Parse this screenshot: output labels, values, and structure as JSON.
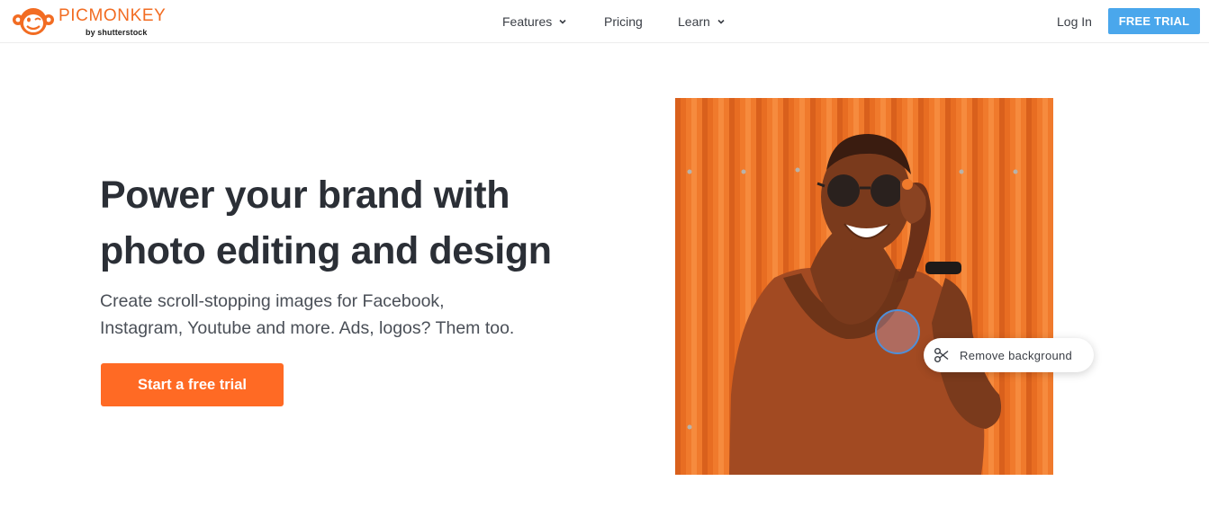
{
  "brand": {
    "name": "PICMONKEY",
    "sub": "by shutterstock",
    "color": "#f26c22"
  },
  "nav": {
    "features": "Features",
    "pricing": "Pricing",
    "learn": "Learn"
  },
  "header_actions": {
    "login": "Log In",
    "free_trial": "FREE TRIAL",
    "free_trial_color": "#4aa7ec"
  },
  "hero": {
    "headline_line1": "Power your brand with",
    "headline_line2": "photo editing and design",
    "subtext_line1": "Create scroll-stopping images for Facebook,",
    "subtext_line2": "Instagram, Youtube and more. Ads, logos? Them too.",
    "cta": "Start a free trial",
    "cta_color": "#ff6a24"
  },
  "photo": {
    "tool_label": "Remove background",
    "tool_icon": "scissors-icon",
    "background_color": "#f07a2c"
  }
}
